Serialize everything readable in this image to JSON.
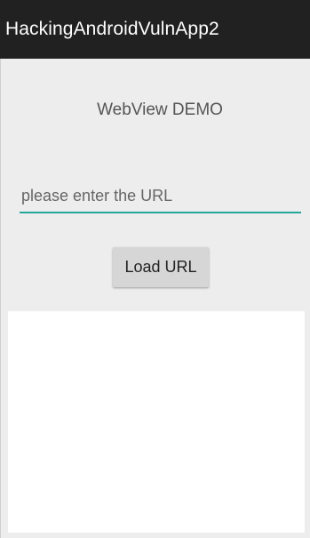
{
  "app_bar": {
    "title": "HackingAndroidVulnApp2"
  },
  "main": {
    "heading": "WebView DEMO",
    "url_input": {
      "value": "",
      "placeholder": "please enter the URL"
    },
    "load_button_label": "Load URL"
  },
  "colors": {
    "action_bar": "#212121",
    "background": "#ededed",
    "input_underline": "#26a69a",
    "button": "#d6d6d6",
    "webview": "#ffffff"
  }
}
